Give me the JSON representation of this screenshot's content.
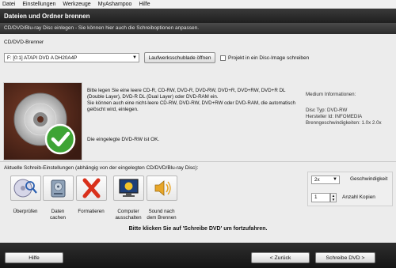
{
  "menu": {
    "items": [
      "Datei",
      "Einstellungen",
      "Werkzeuge",
      "MyAshampoo",
      "Hilfe"
    ]
  },
  "header": {
    "title": "Dateien und Ordner brennen",
    "subtitle": "CD/DVD/Blu-ray Disc einlegen - Sie können hier auch die Schreiboptionen anpassen."
  },
  "burner": {
    "section_label": "CD/DVD-Brenner",
    "drive_value": "F: [0:1] ATAPI   DVD A  DH20A4P",
    "eject_label": "Laufwerksschublade öffnen",
    "image_checkbox_label": "Projekt in ein Disc-Image schreiben",
    "image_checked": false
  },
  "description": {
    "line1": "Bitte legen Sie eine leere CD-R, CD-RW, DVD-R, DVD-RW, DVD+R, DVD+RW, DVD+R DL (Double Layer), DVD-R DL (Dual Layer) oder DVD-RAM ein.",
    "line2": "Sie können auch eine nicht-leere CD-RW, DVD-RW, DVD+RW oder DVD-RAM, die automatisch gelöscht wird, einlegen.",
    "status": "Die eingelegte DVD-RW ist OK."
  },
  "media_info": {
    "title": "Medium Informationen:",
    "disc_type": "Disc Typ: DVD-RW",
    "manufacturer": "Hersteller Id: INFOMEDIA",
    "speeds": "Brenngeschwindigkeiten: 1.0x 2.0x"
  },
  "settings": {
    "label": "Aktuelle Schreib-Einstellungen (abhängig von der eingelegten CD/DVD/Blu-ray Disc):",
    "icons": [
      {
        "label1": "Überprüfen",
        "label2": ""
      },
      {
        "label1": "Daten",
        "label2": "cachen"
      },
      {
        "label1": "Formatieren",
        "label2": ""
      },
      {
        "label1": "Computer",
        "label2": "ausschalten"
      },
      {
        "label1": "Sound nach",
        "label2": "dem Brennen"
      }
    ],
    "speed_value": "2x",
    "speed_label": "Geschwindigkeit",
    "copies_value": "1",
    "copies_label": "Anzahl Kopien"
  },
  "prompt": "Bitte klicken Sie auf 'Schreibe DVD' um fortzufahren.",
  "footer": {
    "help_label": "Hilfe",
    "back_label": "< Zurück",
    "next_label": "Schreibe DVD >"
  },
  "colors": {
    "success_green": "#3ea435",
    "cancel_red": "#d9301b",
    "dark_header": "#262626",
    "panel_bg": "#ececec"
  }
}
